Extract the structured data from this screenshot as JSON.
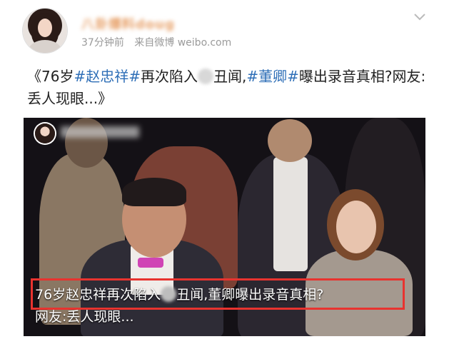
{
  "post": {
    "user_name": "八卦爆料doug",
    "time": "37分钟前",
    "source": "来自微博 weibo.com",
    "headline": {
      "part1": "《76岁",
      "tag1": "#赵忠祥#",
      "part2": "再次陷入",
      "part3": "丑闻,",
      "tag2": "#董卿#",
      "part4": "曝出录音真相?网友:丢人现眼...》"
    }
  },
  "video": {
    "caption_line1_a": "76岁赵忠祥再次陷入",
    "caption_line1_b": "丑闻,董卿曝出录音真相?",
    "caption_line2": "网友:丢人现眼..."
  },
  "colors": {
    "tag": "#2f6fb7",
    "highlight_box": "#e8332f",
    "meta": "#9a9a9a"
  },
  "icons": [
    "avatar",
    "chevron-down-icon"
  ]
}
